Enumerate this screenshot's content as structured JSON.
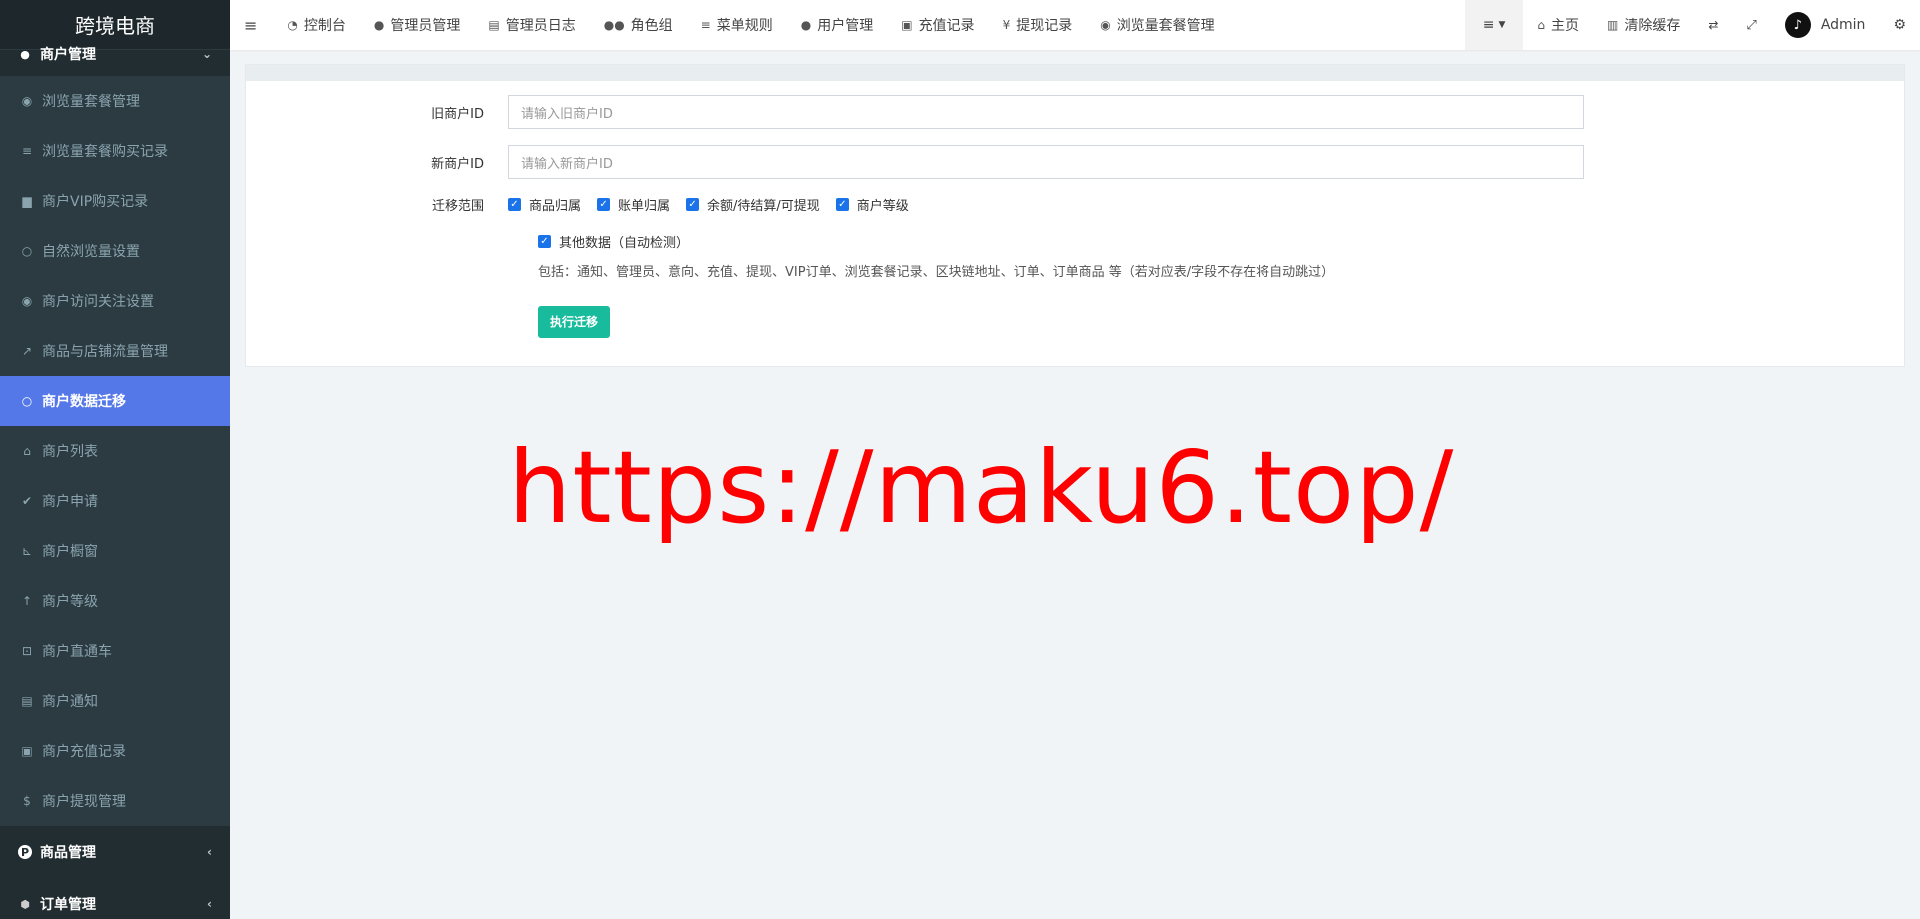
{
  "sidebar": {
    "logo": "跨境电商",
    "group_top": {
      "label": "商户管理",
      "icon": "apple-icon"
    },
    "items": [
      {
        "label": "浏览量套餐管理",
        "icon": "eye-icon",
        "glyph": "◉"
      },
      {
        "label": "浏览量套餐购买记录",
        "icon": "list-icon",
        "glyph": "≡"
      },
      {
        "label": "商户VIP购买记录",
        "icon": "shopping-bag-icon",
        "glyph": "▆"
      },
      {
        "label": "自然浏览量设置",
        "icon": "circle-icon",
        "glyph": "○"
      },
      {
        "label": "商户访问关注设置",
        "icon": "eye-icon",
        "glyph": "◉"
      },
      {
        "label": "商品与店铺流量管理",
        "icon": "line-chart-icon",
        "glyph": "↗"
      },
      {
        "label": "商户数据迁移",
        "icon": "circle-icon",
        "glyph": "○"
      },
      {
        "label": "商户列表",
        "icon": "home-icon",
        "glyph": "⌂"
      },
      {
        "label": "商户申请",
        "icon": "check-circle-icon",
        "glyph": "✔"
      },
      {
        "label": "商户橱窗",
        "icon": "cart-icon",
        "glyph": "⊾"
      },
      {
        "label": "商户等级",
        "icon": "level-up-icon",
        "glyph": "↑"
      },
      {
        "label": "商户直通车",
        "icon": "car-icon",
        "glyph": "⊡"
      },
      {
        "label": "商户通知",
        "icon": "newspaper-icon",
        "glyph": "▤"
      },
      {
        "label": "商户充值记录",
        "icon": "money-icon",
        "glyph": "▣"
      },
      {
        "label": "商户提现管理",
        "icon": "dollar-icon",
        "glyph": "$"
      }
    ],
    "active_index": 6,
    "bottom_groups": [
      {
        "label": "商品管理",
        "icon": "product-hunt-icon",
        "glyph": "P"
      },
      {
        "label": "订单管理",
        "icon": "cube-icon",
        "glyph": "⬢"
      }
    ]
  },
  "topnav": {
    "items": [
      {
        "label": "控制台",
        "icon": "dashboard-icon",
        "glyph": "◔"
      },
      {
        "label": "管理员管理",
        "icon": "user-icon",
        "glyph": "●"
      },
      {
        "label": "管理员日志",
        "icon": "list-alt-icon",
        "glyph": "▤"
      },
      {
        "label": "角色组",
        "icon": "group-icon",
        "glyph": "●●"
      },
      {
        "label": "菜单规则",
        "icon": "bars-icon",
        "glyph": "≡"
      },
      {
        "label": "用户管理",
        "icon": "user-icon",
        "glyph": "●"
      },
      {
        "label": "充值记录",
        "icon": "money-icon",
        "glyph": "▣"
      },
      {
        "label": "提现记录",
        "icon": "yen-icon",
        "glyph": "¥"
      },
      {
        "label": "浏览量套餐管理",
        "icon": "eye-icon",
        "glyph": "◉"
      }
    ],
    "right": {
      "home": "主页",
      "clear_cache": "清除缓存",
      "user": "Admin"
    }
  },
  "form": {
    "old_id_label": "旧商户ID",
    "old_id_placeholder": "请输入旧商户ID",
    "new_id_label": "新商户ID",
    "new_id_placeholder": "请输入新商户ID",
    "scope_label": "迁移范围",
    "scope_options": [
      "商品归属",
      "账单归属",
      "余额/待结算/可提现",
      "商户等级"
    ],
    "other_data": "其他数据（自动检测）",
    "help": "包括：通知、管理员、意向、充值、提现、VIP订单、浏览套餐记录、区块链地址、订单、订单商品 等（若对应表/字段不存在将自动跳过）",
    "submit": "执行迁移"
  },
  "watermark": "https://maku6.top/",
  "colors": {
    "sidebar_bg": "#222d32",
    "active": "#5578e8",
    "button": "#18bc9c",
    "checkbox": "#1a73e8",
    "watermark": "#ff0000"
  }
}
